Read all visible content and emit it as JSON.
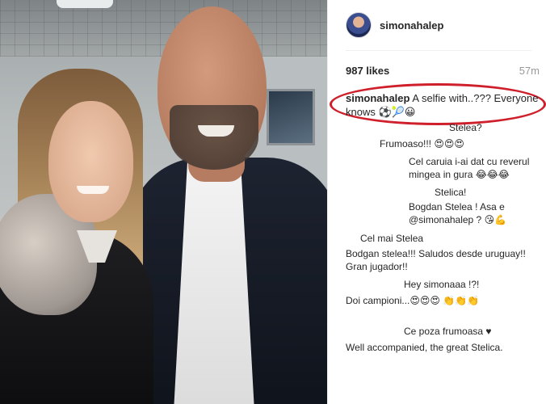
{
  "post": {
    "username": "simonahalep",
    "likes": "987 likes",
    "time": "57m",
    "caption_user": "simonahalep",
    "caption_text": "A selfie with..??? Everyone knows ⚽🎾😀"
  },
  "comments": [
    {
      "text": "Stelea?"
    },
    {
      "text": "Frumoaso!!! 😍😍😍"
    },
    {
      "text": "Cel caruia i-ai dat cu reverul mingea in gura 😂😂😂"
    },
    {
      "text": "Stelica!"
    },
    {
      "text": "Bogdan Stelea ! Asa e @simonahalep ? 😘💪"
    },
    {
      "text": "Cel mai Stelea"
    },
    {
      "text": "Bodgan stelea!!! Saludos desde uruguay!! Gran jugador!!"
    },
    {
      "text": "Hey simonaaa !?!"
    },
    {
      "text": "Doi campioni...😍😍😍 👏👏👏"
    },
    {
      "text": "Ce poza frumoasa ♥"
    },
    {
      "text": "Well accompanied, the great Stelica."
    }
  ],
  "colors": {
    "highlight": "#cf1f2b",
    "muted": "#999999",
    "text": "#262626"
  }
}
